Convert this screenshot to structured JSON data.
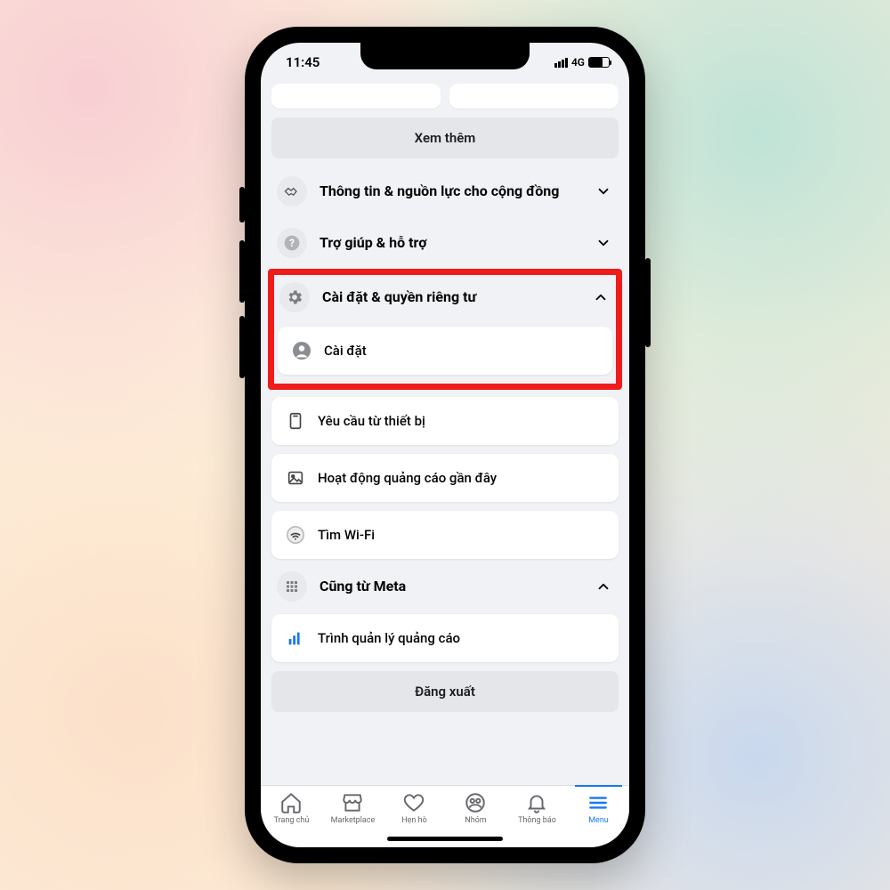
{
  "status": {
    "time": "11:45",
    "network": "4G"
  },
  "buttons": {
    "see_more": "Xem thêm",
    "logout": "Đăng xuất"
  },
  "sections": {
    "community": {
      "label": "Thông tin & nguồn lực cho cộng đồng"
    },
    "help": {
      "label": "Trợ giúp & hỗ trợ"
    },
    "settings": {
      "label": "Cài đặt & quyền riêng tư"
    },
    "meta": {
      "label": "Cũng từ Meta"
    }
  },
  "items": {
    "settings": "Cài đặt",
    "device_req": "Yêu cầu từ thiết bị",
    "ad_activity": "Hoạt động quảng cáo gần đây",
    "find_wifi": "Tìm Wi-Fi",
    "ads_manager": "Trình quản lý quảng cáo"
  },
  "nav": {
    "home": "Trang chủ",
    "market": "Marketplace",
    "dating": "Hẹn hò",
    "groups": "Nhóm",
    "notif": "Thông báo",
    "menu": "Menu"
  }
}
